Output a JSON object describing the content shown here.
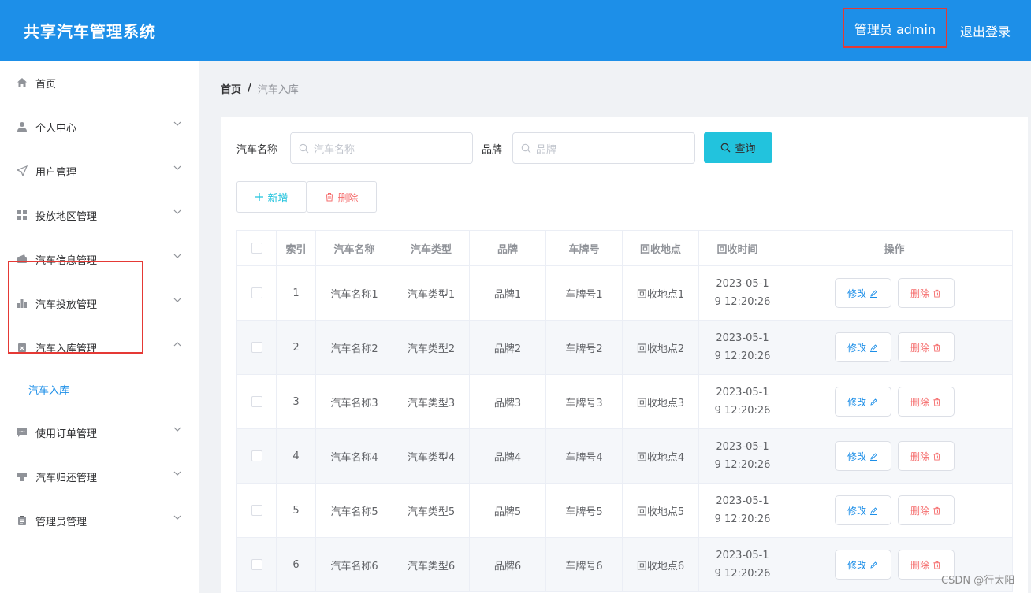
{
  "app": {
    "title": "共享汽车管理系统",
    "user": "管理员 admin",
    "logout": "退出登录"
  },
  "sidebar": {
    "items": [
      {
        "label": "首页",
        "icon": "home-icon"
      },
      {
        "label": "个人中心",
        "icon": "user-icon"
      },
      {
        "label": "用户管理",
        "icon": "navigation-icon"
      },
      {
        "label": "投放地区管理",
        "icon": "grid-icon"
      },
      {
        "label": "汽车信息管理",
        "icon": "wallet-icon"
      },
      {
        "label": "汽车投放管理",
        "icon": "bar-chart-icon"
      },
      {
        "label": "汽车入库管理",
        "icon": "inventory-icon"
      },
      {
        "label": "使用订单管理",
        "icon": "message-icon"
      },
      {
        "label": "汽车归还管理",
        "icon": "return-icon"
      },
      {
        "label": "管理员管理",
        "icon": "clipboard-icon"
      }
    ],
    "active_sub": "汽车入库"
  },
  "breadcrumb": {
    "home": "首页",
    "separator": "/",
    "current": "汽车入库"
  },
  "search": {
    "car_name_label": "汽车名称",
    "car_name_placeholder": "汽车名称",
    "brand_label": "品牌",
    "brand_placeholder": "品牌",
    "query_label": "查询"
  },
  "toolbar": {
    "add_label": "新增",
    "delete_label": "删除"
  },
  "table": {
    "headers": [
      "索引",
      "汽车名称",
      "汽车类型",
      "品牌",
      "车牌号",
      "回收地点",
      "回收时间",
      "操作"
    ],
    "edit_label": "修改",
    "delete_label": "删除",
    "rows": [
      {
        "index": "1",
        "name": "汽车名称1",
        "type": "汽车类型1",
        "brand": "品牌1",
        "plate": "车牌号1",
        "location": "回收地点1",
        "time_line1": "2023-05-1",
        "time_line2": "9 12:20:26"
      },
      {
        "index": "2",
        "name": "汽车名称2",
        "type": "汽车类型2",
        "brand": "品牌2",
        "plate": "车牌号2",
        "location": "回收地点2",
        "time_line1": "2023-05-1",
        "time_line2": "9 12:20:26"
      },
      {
        "index": "3",
        "name": "汽车名称3",
        "type": "汽车类型3",
        "brand": "品牌3",
        "plate": "车牌号3",
        "location": "回收地点3",
        "time_line1": "2023-05-1",
        "time_line2": "9 12:20:26"
      },
      {
        "index": "4",
        "name": "汽车名称4",
        "type": "汽车类型4",
        "brand": "品牌4",
        "plate": "车牌号4",
        "location": "回收地点4",
        "time_line1": "2023-05-1",
        "time_line2": "9 12:20:26"
      },
      {
        "index": "5",
        "name": "汽车名称5",
        "type": "汽车类型5",
        "brand": "品牌5",
        "plate": "车牌号5",
        "location": "回收地点5",
        "time_line1": "2023-05-1",
        "time_line2": "9 12:20:26"
      },
      {
        "index": "6",
        "name": "汽车名称6",
        "type": "汽车类型6",
        "brand": "品牌6",
        "plate": "车牌号6",
        "location": "回收地点6",
        "time_line1": "2023-05-1",
        "time_line2": "9 12:20:26"
      }
    ]
  },
  "watermark": "CSDN @行太阳",
  "colors": {
    "header": "#1d8fe8",
    "accent": "#22c3dd",
    "danger": "#f56c6c",
    "highlight": "#e53935"
  }
}
